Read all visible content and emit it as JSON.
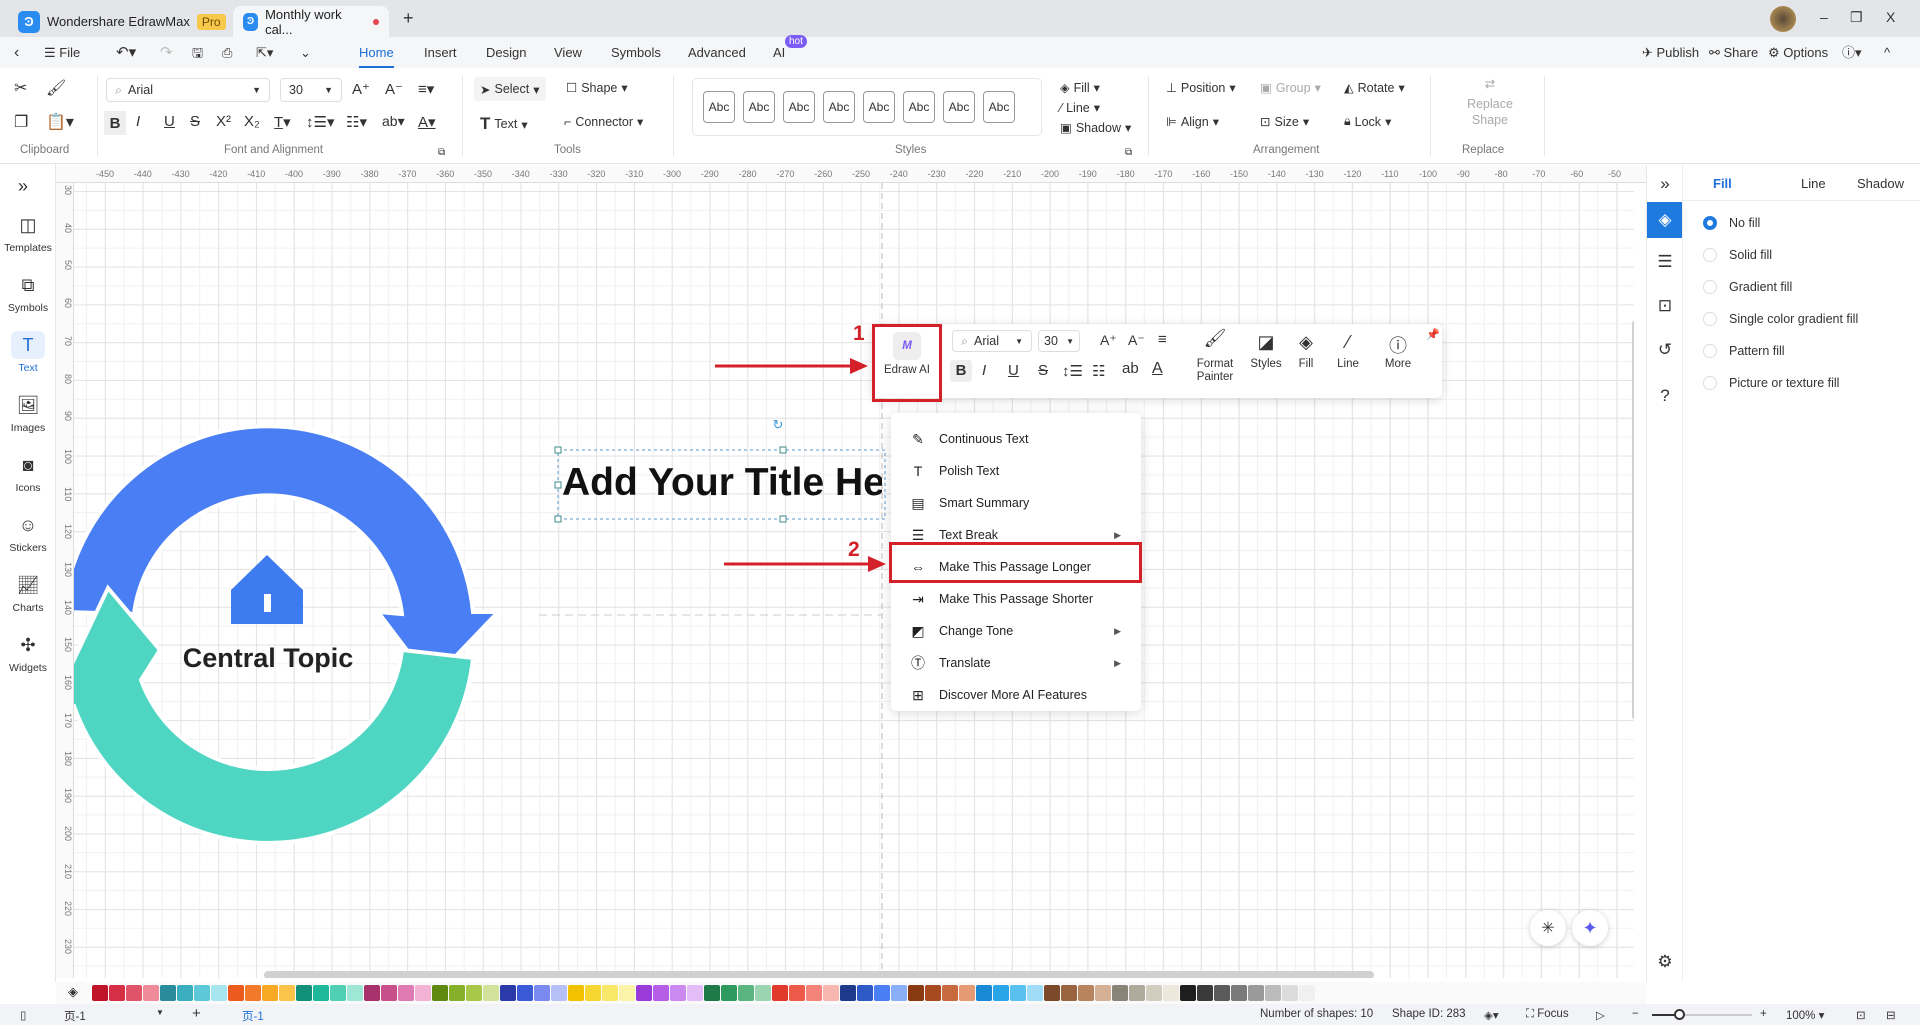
{
  "titlebar": {
    "app_name": "Wondershare EdrawMax",
    "badge": "Pro",
    "doc_tab": "Monthly work cal...",
    "new_tab": "+",
    "window": {
      "minimize": "–",
      "restore": "❐",
      "close": "X"
    }
  },
  "menubar": {
    "file": "File",
    "tabs": [
      "Home",
      "Insert",
      "Design",
      "View",
      "Symbols",
      "Advanced",
      "AI"
    ],
    "active": "Home",
    "ai_badge": "hot",
    "right": {
      "publish": "Publish",
      "share": "Share",
      "options": "Options"
    }
  },
  "ribbon": {
    "font": "Arial",
    "size": "30",
    "tools": {
      "select": "Select",
      "shape": "Shape",
      "text": "Text",
      "connector": "Connector"
    },
    "styles": [
      "Abc",
      "Abc",
      "Abc",
      "Abc",
      "Abc",
      "Abc",
      "Abc",
      "Abc"
    ],
    "fill": "Fill",
    "line": "Line",
    "shadow": "Shadow",
    "arrangement": {
      "position": "Position",
      "group": "Group",
      "rotate": "Rotate",
      "align": "Align",
      "size": "Size",
      "lock": "Lock"
    },
    "replace": "Replace Shape",
    "groups": [
      "Clipboard",
      "Font and Alignment",
      "Tools",
      "Styles",
      "Arrangement",
      "Replace"
    ]
  },
  "sidebar": {
    "items": [
      {
        "label": "Templates",
        "icon": "templates-icon"
      },
      {
        "label": "Symbols",
        "icon": "symbols-icon"
      },
      {
        "label": "Text",
        "icon": "text-icon",
        "active": true
      },
      {
        "label": "Images",
        "icon": "images-icon"
      },
      {
        "label": "Icons",
        "icon": "icons-icon"
      },
      {
        "label": "Stickers",
        "icon": "stickers-icon"
      },
      {
        "label": "Charts",
        "icon": "charts-icon"
      },
      {
        "label": "Widgets",
        "icon": "widgets-icon"
      }
    ]
  },
  "ruler": {
    "top": [
      "-450",
      "-440",
      "-430",
      "-420",
      "-410",
      "-400",
      "-390",
      "-380",
      "-370",
      "-360",
      "-350",
      "-340",
      "-330",
      "-320",
      "-310",
      "-300",
      "-290",
      "-280",
      "-270",
      "-260",
      "-250",
      "-240",
      "-230",
      "-220",
      "-210",
      "-200",
      "-190",
      "-180",
      "-170",
      "-160",
      "-150",
      "-140",
      "-130",
      "-120",
      "-110",
      "-100",
      "-90",
      "-80",
      "-70",
      "-60",
      "-50"
    ],
    "left": [
      "30",
      "40",
      "50",
      "60",
      "70",
      "80",
      "90",
      "100",
      "110",
      "120",
      "130",
      "140",
      "150",
      "160",
      "170",
      "180",
      "190",
      "200",
      "210",
      "220",
      "230"
    ]
  },
  "canvas": {
    "title_text": "Add Your Title He",
    "central_topic": "Central Topic",
    "colors": {
      "blue": "#4a7ef5",
      "teal": "#4fd6c3",
      "house": "#3f7bf0"
    }
  },
  "floating_toolbar": {
    "edraw_ai": "Edraw AI",
    "font": "Arial",
    "size": "30",
    "format_painter": "Format Painter",
    "styles": "Styles",
    "fill": "Fill",
    "line": "Line",
    "more": "More"
  },
  "ai_menu": {
    "items": [
      {
        "label": "Continuous Text",
        "icon": "continuous-text-icon"
      },
      {
        "label": "Polish Text",
        "icon": "polish-text-icon"
      },
      {
        "label": "Smart Summary",
        "icon": "smart-summary-icon"
      },
      {
        "label": "Text Break",
        "icon": "text-break-icon",
        "submenu": true
      },
      {
        "label": "Make This Passage Longer",
        "icon": "passage-longer-icon",
        "highlighted": true
      },
      {
        "label": "Make This Passage Shorter",
        "icon": "passage-shorter-icon"
      },
      {
        "label": "Change Tone",
        "icon": "change-tone-icon",
        "submenu": true
      },
      {
        "label": "Translate",
        "icon": "translate-icon",
        "submenu": true
      },
      {
        "label": "Discover More AI Features",
        "icon": "discover-icon"
      }
    ]
  },
  "annotations": {
    "step1": "1",
    "step2": "2",
    "color": "#d42029"
  },
  "panel": {
    "tabs": [
      "Fill",
      "Line",
      "Shadow"
    ],
    "active_tab": "Fill",
    "options": [
      "No fill",
      "Solid fill",
      "Gradient fill",
      "Single color gradient fill",
      "Pattern fill",
      "Picture or texture fill"
    ],
    "selected": "No fill"
  },
  "palette": [
    "#c0142a",
    "#d42f45",
    "#e0546a",
    "#ee8a9a",
    "#2a8c9a",
    "#3aaebe",
    "#5cc8d8",
    "#a8e6ef",
    "#ec5a1e",
    "#f07a2a",
    "#f9a825",
    "#fcc34a",
    "#12907a",
    "#1fb89a",
    "#4fd0b4",
    "#9ee6d6",
    "#a8326e",
    "#c8508a",
    "#e07ab2",
    "#f1b2d4",
    "#5e8a12",
    "#86b02a",
    "#a8c84a",
    "#d2e29a",
    "#2a3aa8",
    "#3a5ad8",
    "#7a8af0",
    "#b6bff6",
    "#f2c200",
    "#f6d630",
    "#f8e86a",
    "#fbf3a8",
    "#9a3ad8",
    "#b65ee6",
    "#cc8af0",
    "#e2bdf8",
    "#1e7a46",
    "#2e9a5e",
    "#5ab67e",
    "#9ad4b0",
    "#e23a2a",
    "#ee5a4a",
    "#f4847a",
    "#f8b6b0",
    "#1e3a8a",
    "#2e5ac8",
    "#4a7ef5",
    "#8aaef8",
    "#8a3a10",
    "#a84a1e",
    "#c86a3e",
    "#e49a72",
    "#1a8ad6",
    "#2aa6e6",
    "#5ac0f0",
    "#a0dcf8",
    "#7a4a2a",
    "#9a6440",
    "#b8845e",
    "#d6b094",
    "#8a8478",
    "#b0aa9c",
    "#d2cdbf",
    "#ece8dc",
    "#1e1e1e",
    "#3a3a3a",
    "#5a5a5a",
    "#7a7a7a",
    "#9a9a9a",
    "#bcbcbc",
    "#dcdcdc",
    "#f0f0f0"
  ],
  "status": {
    "page_select": "页-1",
    "page_tab": "页-1",
    "add": "+",
    "shapes": "Number of shapes: 10",
    "shape_id": "Shape ID: 283",
    "focus": "Focus",
    "zoom": "100%"
  }
}
